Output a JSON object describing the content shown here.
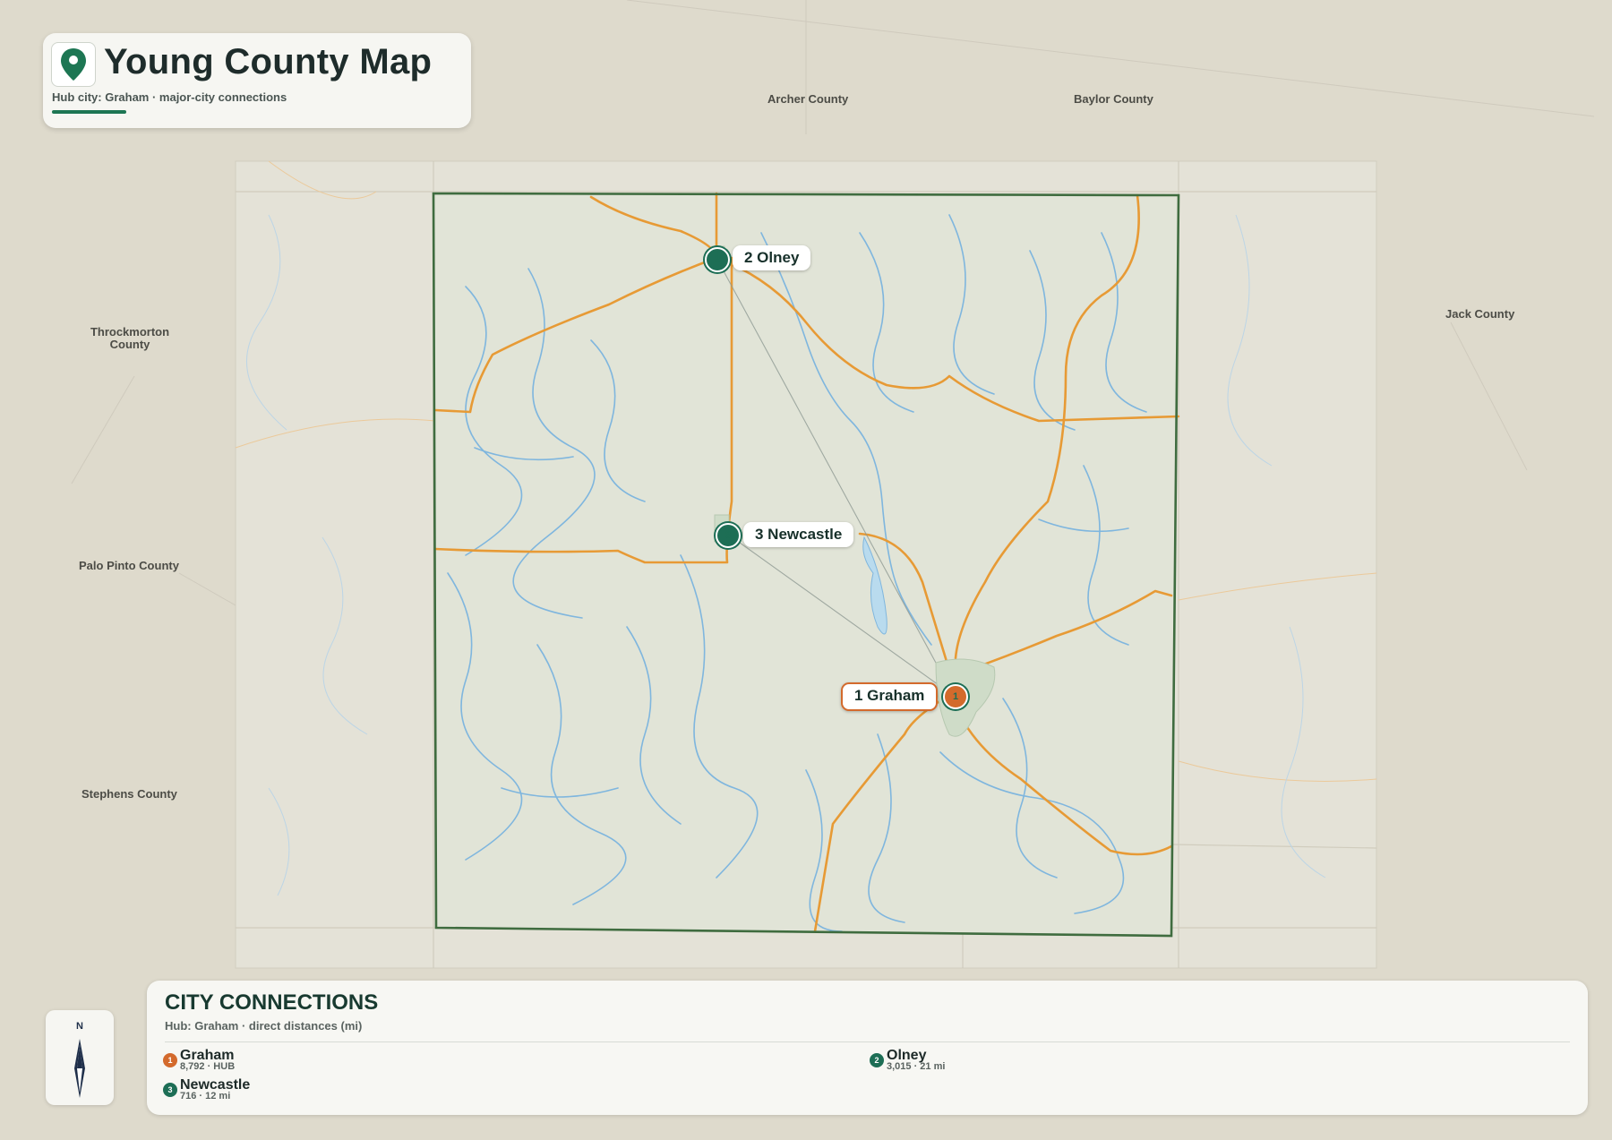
{
  "header": {
    "title": "Young County Map",
    "subtitle": "Hub city: Graham · major-city connections"
  },
  "colors": {
    "hub": "#d36a2c",
    "city": "#1d6e55",
    "road": "#e79a35",
    "water": "#7fb6de",
    "county_border": "#3f6c3f",
    "accent": "#1d7653"
  },
  "neighboring_counties": [
    "Archer County",
    "Baylor County",
    "Throckmorton County",
    "Jack County",
    "Palo Pinto County",
    "Stephens County"
  ],
  "cities": [
    {
      "rank": "1",
      "label": "1 Graham",
      "role": "hub"
    },
    {
      "rank": "2",
      "label": "2 Olney",
      "role": "city"
    },
    {
      "rank": "3",
      "label": "3 Newcastle",
      "role": "city"
    }
  ],
  "compass": {
    "north_label": "N",
    "icon": "compass-needle-icon"
  },
  "connections_panel": {
    "title": "CITY CONNECTIONS",
    "subtitle": "Hub: Graham · direct distances (mi)",
    "items": [
      {
        "rank": "1",
        "name": "Graham",
        "meta": "8,792 · HUB"
      },
      {
        "rank": "2",
        "name": "Olney",
        "meta": "3,015 · 21 mi"
      },
      {
        "rank": "3",
        "name": "Newcastle",
        "meta": "716 · 12 mi"
      }
    ]
  }
}
